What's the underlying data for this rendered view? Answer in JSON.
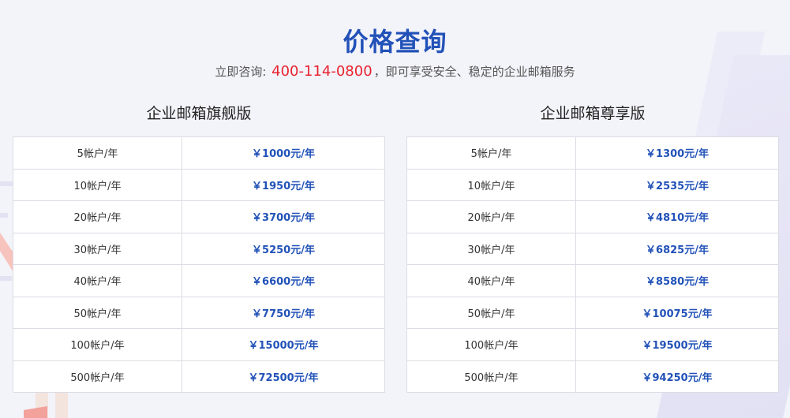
{
  "header": {
    "title": "价格查询",
    "subtitle_prefix": "立即咨询: ",
    "phone": "400-114-0800",
    "subtitle_suffix": "，即可享受安全、稳定的企业邮箱服务"
  },
  "plans": [
    {
      "name": "企业邮箱旗舰版",
      "rows": [
        {
          "accounts": "5帐户/年",
          "price": "￥1000元/年"
        },
        {
          "accounts": "10帐户/年",
          "price": "￥1950元/年"
        },
        {
          "accounts": "20帐户/年",
          "price": "￥3700元/年"
        },
        {
          "accounts": "30帐户/年",
          "price": "￥5250元/年"
        },
        {
          "accounts": "40帐户/年",
          "price": "￥6600元/年"
        },
        {
          "accounts": "50帐户/年",
          "price": "￥7750元/年"
        },
        {
          "accounts": "100帐户/年",
          "price": "￥15000元/年"
        },
        {
          "accounts": "500帐户/年",
          "price": "￥72500元/年"
        }
      ]
    },
    {
      "name": "企业邮箱尊享版",
      "rows": [
        {
          "accounts": "5帐户/年",
          "price": "￥1300元/年"
        },
        {
          "accounts": "10帐户/年",
          "price": "￥2535元/年"
        },
        {
          "accounts": "20帐户/年",
          "price": "￥4810元/年"
        },
        {
          "accounts": "30帐户/年",
          "price": "￥6825元/年"
        },
        {
          "accounts": "40帐户/年",
          "price": "￥8580元/年"
        },
        {
          "accounts": "50帐户/年",
          "price": "￥10075元/年"
        },
        {
          "accounts": "100帐户/年",
          "price": "￥19500元/年"
        },
        {
          "accounts": "500帐户/年",
          "price": "￥94250元/年"
        }
      ]
    }
  ],
  "colors": {
    "title": "#2252b8",
    "phone": "#e8232e",
    "price": "#2252b8",
    "background": "#f3f3fa"
  }
}
